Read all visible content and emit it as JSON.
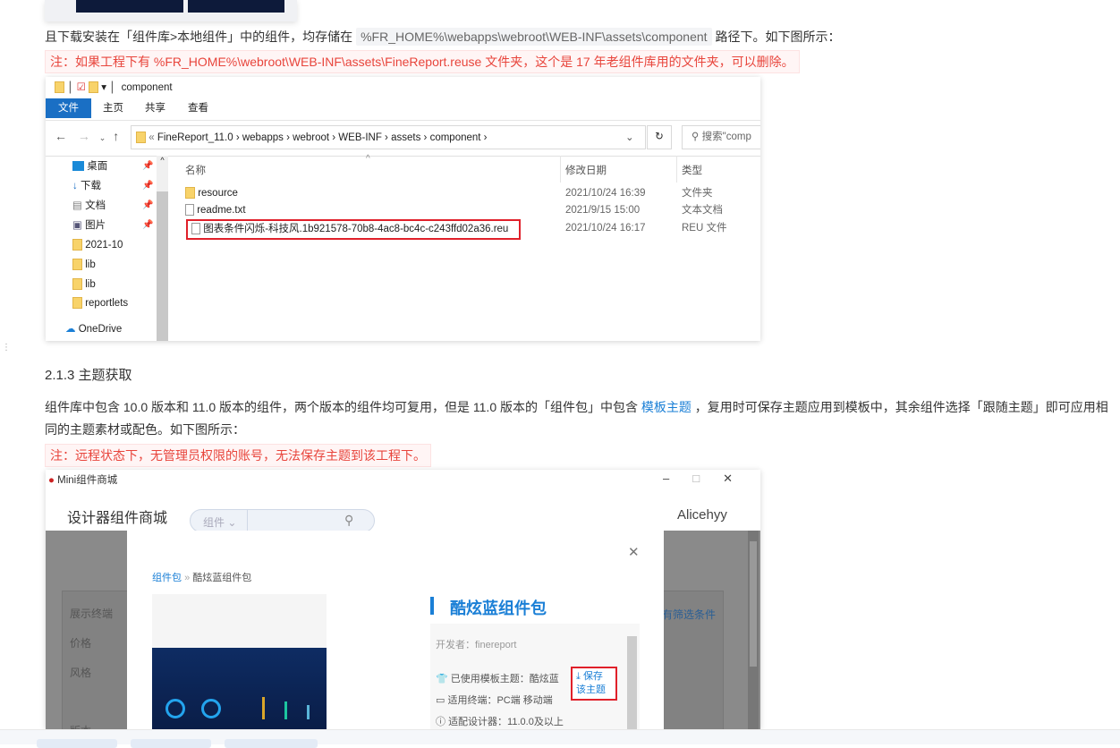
{
  "intro": {
    "text_before": "且下载安装在「组件库>本地组件」中的组件，均存储在",
    "path": "%FR_HOME%\\webapps\\webroot\\WEB-INF\\assets\\component",
    "text_after": "路径下。如下图所示："
  },
  "note1": "注：如果工程下有 %FR_HOME%\\webroot\\WEB-INF\\assets\\FineReport.reuse 文件夹，这个是 17 年老组件库用的文件夹，可以删除。",
  "explorer": {
    "title": "component",
    "ribbon_tabs": [
      "文件",
      "主页",
      "共享",
      "查看"
    ],
    "breadcrumb": [
      "FineReport_11.0",
      "webapps",
      "webroot",
      "WEB-INF",
      "assets",
      "component"
    ],
    "search_placeholder": "搜索\"comp",
    "nav": [
      {
        "label": "桌面",
        "pinned": true
      },
      {
        "label": "下载",
        "pinned": true
      },
      {
        "label": "文档",
        "pinned": true
      },
      {
        "label": "图片",
        "pinned": true
      },
      {
        "label": "2021-10"
      },
      {
        "label": "lib"
      },
      {
        "label": "lib"
      },
      {
        "label": "reportlets"
      },
      {
        "label": "OneDrive"
      }
    ],
    "columns": [
      "名称",
      "修改日期",
      "类型"
    ],
    "files": [
      {
        "name": "resource",
        "date": "2021/10/24 16:39",
        "type": "文件夹",
        "icon": "folder-icon"
      },
      {
        "name": "readme.txt",
        "date": "2021/9/15 15:00",
        "type": "文本文档",
        "icon": "text-file-icon"
      },
      {
        "name": "图表条件闪烁-科技风.1b921578-70b8-4ac8-bc4c-c243ffd02a36.reu",
        "date": "2021/10/24 16:17",
        "type": "REU 文件",
        "icon": "file-icon",
        "highlighted": true
      }
    ]
  },
  "section": {
    "heading": "2.1.3 主题获取",
    "para_1": "组件库中包含 10.0 版本和 11.0 版本的组件，两个版本的组件均可复用，但是 11.0 版本的「组件包」中包含",
    "link": "模板主题",
    "para_2": "，复用时可保存主题应用到模板中，其余组件选择「跟随主题」即可应用相",
    "para_3": "同的主题素材或配色。如下图所示："
  },
  "note2": "注：远程状态下，无管理员权限的账号，无法保存主题到该工程下。",
  "mini": {
    "window_title": "Mini组件商城",
    "store_title": "设计器组件商城",
    "search_category": "组件",
    "user": "Alicehyy",
    "filters": [
      "展示终端",
      "价格",
      "风格",
      "版本"
    ],
    "filter_right": "有筛选条件",
    "breadcrumb_root": "组件包",
    "breadcrumb_current": "酷炫蓝组件包",
    "package_title": "酷炫蓝组件包",
    "developer": "开发者：finereport",
    "theme_used": "已使用模板主题：酷炫蓝",
    "save_theme": "保存该主题",
    "terminals": "适用终端：PC端  移动端",
    "designer": "适配设计器：11.0.0及以上"
  },
  "colors": {
    "link": "#1a7fd6",
    "note_red": "#e8453c",
    "explorer_blue": "#1a6fc4",
    "highlight_box": "#e0202a"
  }
}
